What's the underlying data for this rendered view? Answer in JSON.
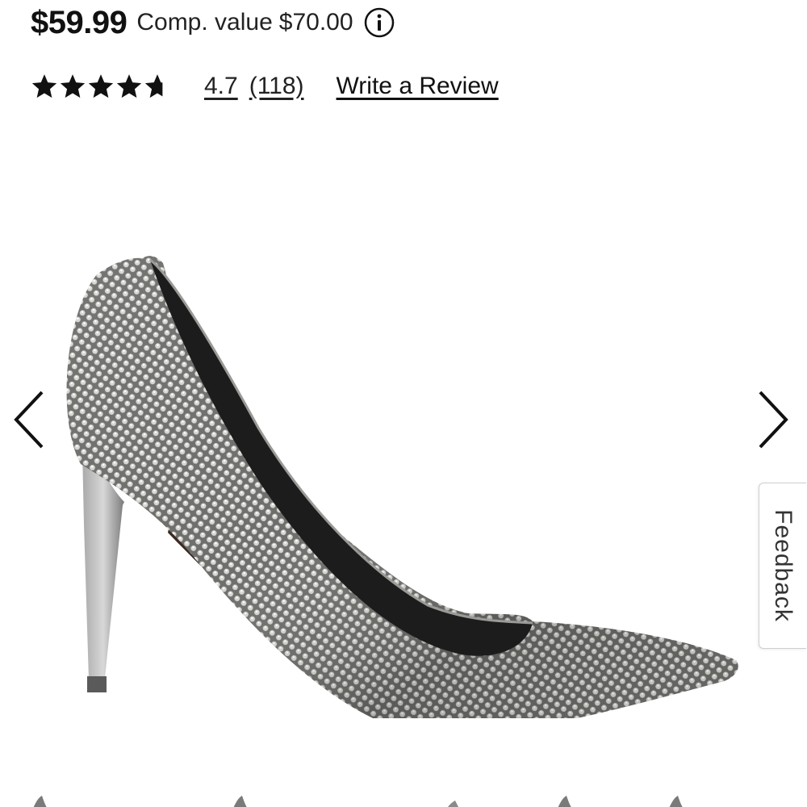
{
  "price": {
    "current": "$59.99",
    "comp_label": "Comp. value",
    "comp_value": "$70.00"
  },
  "rating": {
    "stars": 4.7,
    "max_stars": 5,
    "value_text": "4.7",
    "count_text": "(118)",
    "write_review_label": "Write a Review"
  },
  "carousel": {
    "image_subject": "silver rhinestone pointed-toe stiletto pump",
    "prev_icon": "chevron-left-icon",
    "next_icon": "chevron-right-icon"
  },
  "feedback": {
    "label": "Feedback"
  },
  "icons": {
    "info": "info-icon",
    "star": "star-icon"
  },
  "colors": {
    "text": "#111111",
    "star": "#111111",
    "link": "#222222"
  }
}
